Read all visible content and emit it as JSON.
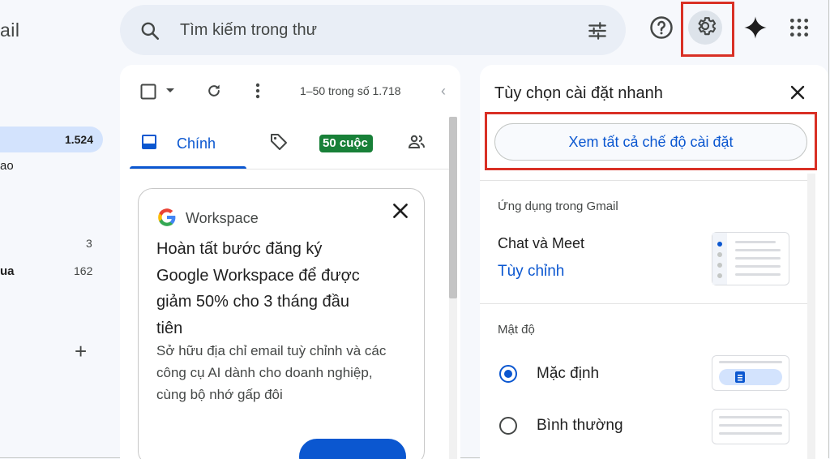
{
  "sidebar": {
    "logo_fragment": "ail",
    "items": [
      {
        "label": "",
        "count": "1.524"
      },
      {
        "label": "ao",
        "count": ""
      },
      {
        "label": "",
        "count": "3"
      },
      {
        "label": "ua",
        "count": "162"
      }
    ],
    "add_label": "+"
  },
  "search": {
    "placeholder": "Tìm kiếm trong thư"
  },
  "header": {
    "icons": [
      "help-icon",
      "gear-icon",
      "gemini-sparkle-icon",
      "apps-grid-icon"
    ]
  },
  "mail_list": {
    "range_text": "1–50 trong số 1.718",
    "tabs": [
      {
        "label": "Chính",
        "icon": "inbox-icon"
      },
      {
        "label": "",
        "icon": "tag-icon",
        "badge": "50 cuộc"
      },
      {
        "label": "",
        "icon": "people-icon"
      }
    ],
    "promo_card": {
      "brand": "Workspace",
      "title": "Hoàn tất bước đăng ký Google Workspace để được giảm 50% cho 3 tháng đầu tiên",
      "description": "Sở hữu địa chỉ email tuỳ chỉnh và các công cụ AI dành cho doanh nghiệp, cùng bộ nhớ gấp đôi"
    }
  },
  "quick_settings": {
    "title": "Tùy chọn cài đặt nhanh",
    "see_all_button": "Xem tất cả chế độ cài đặt",
    "apps_section": "Ứng dụng trong Gmail",
    "chat_meet_label": "Chat và Meet",
    "customize_link": "Tùy chỉnh",
    "density_section": "Mật độ",
    "density_options": [
      {
        "label": "Mặc định",
        "selected": true
      },
      {
        "label": "Bình thường",
        "selected": false
      }
    ]
  },
  "colors": {
    "accent": "#0b57d0",
    "highlight_box": "#d93025",
    "active_nav": "#d3e3fd",
    "badge_green": "#188038"
  }
}
